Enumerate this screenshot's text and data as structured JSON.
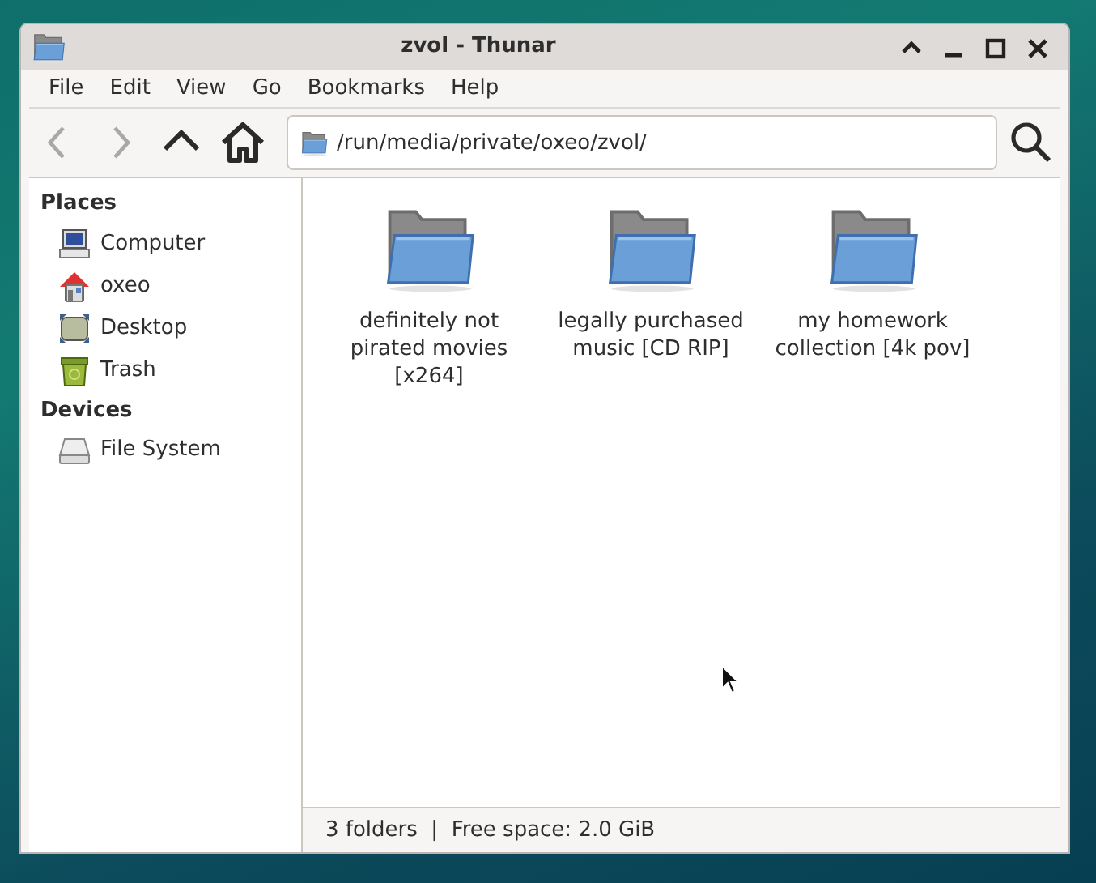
{
  "window": {
    "title": "zvol - Thunar"
  },
  "menu": [
    "File",
    "Edit",
    "View",
    "Go",
    "Bookmarks",
    "Help"
  ],
  "toolbar": {
    "buttons": [
      {
        "kind": "back",
        "disabled": true
      },
      {
        "kind": "forward",
        "disabled": true
      },
      {
        "kind": "up",
        "disabled": false
      },
      {
        "kind": "home",
        "disabled": false
      }
    ],
    "location": "/run/media/private/oxeo/zvol/"
  },
  "sidebar": [
    {
      "heading": "Places",
      "items": [
        {
          "label": "Computer",
          "kind": "computer"
        },
        {
          "label": "oxeo",
          "kind": "home"
        },
        {
          "label": "Desktop",
          "kind": "desktop"
        },
        {
          "label": "Trash",
          "kind": "trash"
        }
      ]
    },
    {
      "heading": "Devices",
      "items": [
        {
          "label": "File System",
          "kind": "drive"
        }
      ]
    }
  ],
  "files": [
    {
      "name": "definitely not pirated movies [x264]"
    },
    {
      "name": "legally purchased music [CD RIP]"
    },
    {
      "name": "my homework collection [4k pov]"
    }
  ],
  "status_bar": "3 folders  |  Free space: 2.0 GiB"
}
